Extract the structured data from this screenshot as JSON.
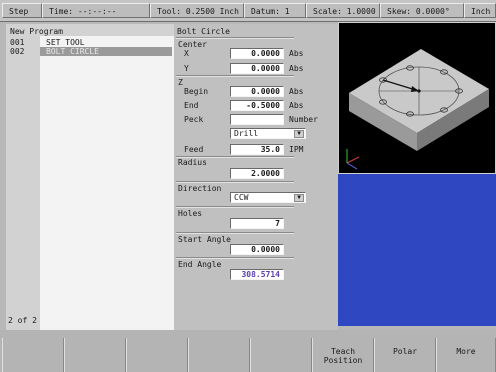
{
  "status_bar": {
    "step_label": "Step",
    "time_label": "Time:",
    "time_value": "--:--:--",
    "tool_label": "Tool:",
    "tool_value": "0.2500",
    "tool_unit": "Inch",
    "datum_label": "Datum:",
    "datum_value": "1",
    "scale_label": "Scale:",
    "scale_value": "1.0000",
    "skew_label": "Skew:",
    "skew_value": "0.0000°",
    "unit_label": "Inch"
  },
  "program": {
    "title": "New Program",
    "items": [
      {
        "num": "001",
        "name": "SET TOOL"
      },
      {
        "num": "002",
        "name": "BOLT CIRCLE"
      }
    ],
    "selected_index": 1,
    "page_count": "2 of 2"
  },
  "form": {
    "title": "Bolt Circle",
    "center_label": "Center",
    "x_label": "X",
    "x_value": "0.0000",
    "x_mode": "Abs",
    "y_label": "Y",
    "y_value": "0.0000",
    "y_mode": "Abs",
    "z_label": "Z",
    "begin_label": "Begin",
    "begin_value": "0.0000",
    "begin_mode": "Abs",
    "end_label": "End",
    "end_value": "-0.5000",
    "end_mode": "Abs",
    "peck_label": "Peck",
    "peck_value": "",
    "peck_mode": "Number",
    "operation_value": "Drill",
    "feed_label": "Feed",
    "feed_value": "35.0",
    "feed_unit": "IPM",
    "radius_label": "Radius",
    "radius_value": "2.0000",
    "direction_label": "Direction",
    "direction_value": "CCW",
    "holes_label": "Holes",
    "holes_value": "7",
    "start_angle_label": "Start Angle",
    "start_angle_value": "0.0000",
    "end_angle_label": "End Angle",
    "end_angle_value": "308.5714"
  },
  "softkeys": [
    "",
    "",
    "",
    "",
    "",
    "Teach\nPosition",
    "Polar",
    "More"
  ],
  "colors": {
    "preview_bg": "#000000",
    "graphics_bg": "#2f48c2",
    "end_angle_text": "#5b3fb3"
  }
}
